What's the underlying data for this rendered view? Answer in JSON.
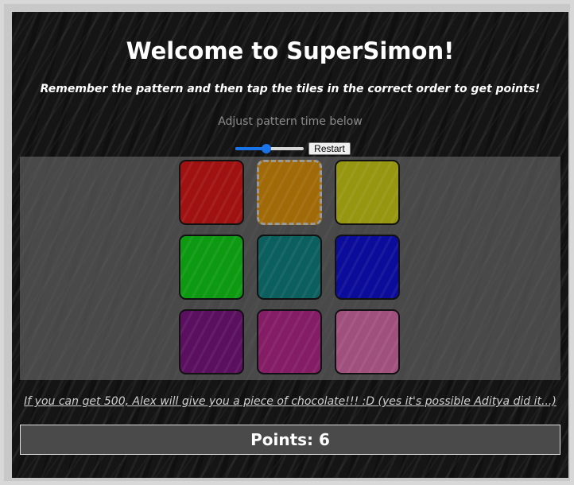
{
  "header": {
    "title": "Welcome to SuperSimon!",
    "subtitle": "Remember the pattern and then tap the tiles in the correct order to get points!",
    "adjust_text": "Adjust pattern time below"
  },
  "controls": {
    "pattern_time_fraction": 0.45,
    "restart_label": "Restart"
  },
  "tiles": [
    {
      "name": "red",
      "color": "#a01212",
      "active": false
    },
    {
      "name": "orange",
      "color": "#a06a08",
      "active": true
    },
    {
      "name": "yellow",
      "color": "#969611",
      "active": false
    },
    {
      "name": "green",
      "color": "#0d9a12",
      "active": false
    },
    {
      "name": "teal",
      "color": "#0c5f5f",
      "active": false
    },
    {
      "name": "blue",
      "color": "#0c0c9a",
      "active": false
    },
    {
      "name": "purple",
      "color": "#5a0f5f",
      "active": false
    },
    {
      "name": "magenta",
      "color": "#841c66",
      "active": false
    },
    {
      "name": "pink",
      "color": "#a0507d",
      "active": false
    }
  ],
  "footer": {
    "chocolate_text": "If you can get 500, Alex will give you a piece of chocolate!!! :D (yes it's possible Aditya did it...)",
    "points_text": "Points: 6"
  }
}
